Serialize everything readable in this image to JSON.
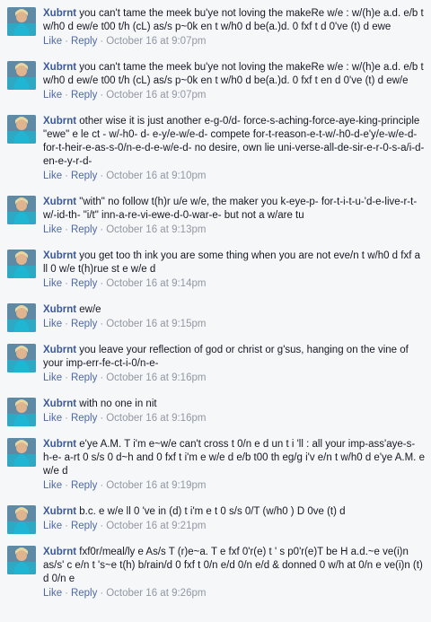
{
  "comments": [
    {
      "author": "Xubrnt",
      "text": "you can't tame the meek bu'ye not loving the makeRe w/e : w/(h)e a.d. e/b t w/h0 d ew/e t00 t/h (cL) as/s p~0k en t w/h0 d be(a.)d. 0 fxf t d 0've (t) d ewe",
      "like": "Like",
      "reply": "Reply",
      "time": "October 16 at 9:07pm"
    },
    {
      "author": "Xubrnt",
      "text": "you can't tame the meek bu'ye not loving the makeRe w/e : w/(h)e a.d. e/b t w/h0 d ew/e t00 t/h (cL) as/s p~0k en t w/h0 d be(a.)d. 0 fxf t en d 0've (t) d ew/e",
      "like": "Like",
      "reply": "Reply",
      "time": "October 16 at 9:07pm"
    },
    {
      "author": "Xubrnt",
      "text": "other wise it is just another e-g-0/d- force-s-aching-force-aye-king-principle \"ewe\" e le ct - w/-h0- d- e-y/e-w/e-d- compete for-t-reason-e-t-w/-h0-d-e'y/e-w/e-d-for-t-heir-e-as-s-0/n-e-d-e-w/e-d- no desire, own lie uni-verse-all-de-sir-e-r-0-s-a/i-d-en-e-y-r-d-",
      "like": "Like",
      "reply": "Reply",
      "time": "October 16 at 9:10pm"
    },
    {
      "author": "Xubrnt",
      "text": "\"with\" no follow t(h)r u/e w/e, the maker you k-eye-p- for-t-i-t-u-'d-e-live-r-t-w/-id-th- \"i/t\" inn-a-re-vi-ewe-d-0-war-e- but not a w/are tu",
      "like": "Like",
      "reply": "Reply",
      "time": "October 16 at 9:13pm"
    },
    {
      "author": "Xubrnt",
      "text": "you get too th ink you are some thing when you are not eve/n t w/h0 d fxf a ll 0 w/e t(h)rue st e w/e d",
      "like": "Like",
      "reply": "Reply",
      "time": "October 16 at 9:14pm"
    },
    {
      "author": "Xubrnt",
      "text": "ew/e",
      "like": "Like",
      "reply": "Reply",
      "time": "October 16 at 9:15pm"
    },
    {
      "author": "Xubrnt",
      "text": "you leave your reflection of god or christ or g'sus, hanging on the vine of your imp-err-fe-ct-i-0/n-e-",
      "like": "Like",
      "reply": "Reply",
      "time": "October 16 at 9:16pm"
    },
    {
      "author": "Xubrnt",
      "text": "with no one in nit",
      "like": "Like",
      "reply": "Reply",
      "time": "October 16 at 9:16pm"
    },
    {
      "author": "Xubrnt",
      "text": "e'ye A.M. T i'm e~w/e can't cross t 0/n e d un t i 'll : all your imp-ass'aye-s- h-e- a-rt 0 s/s 0 d~h and 0 fxf t i'm e w/e d e/b t00 th eg/g i'v e/n t w/h0 d e'ye A.M. e w/e d",
      "like": "Like",
      "reply": "Reply",
      "time": "October 16 at 9:19pm"
    },
    {
      "author": "Xubrnt",
      "text": "b.c. e w/e ll 0 've in (d) t i'm e t 0 s/s 0/T (w/h0 ) D 0ve (t) d",
      "like": "Like",
      "reply": "Reply",
      "time": "October 16 at 9:21pm"
    },
    {
      "author": "Xubrnt",
      "text": "fxf0r/meal/ly e As/s T (r)e~a. T e fxf 0'r(e) t ' s p0'r(e)T be H a.d.~e ve(i)n as/s' c e/n t 's~e t(h) b/rain/d 0 fxf t 0/n e/d 0/n e/d & donned 0 w/h at 0/n e ve(i)n (t) d 0/n e",
      "like": "Like",
      "reply": "Reply",
      "time": "October 16 at 9:26pm"
    }
  ],
  "colors": {
    "author": "#3b5998",
    "link": "#4e69a2",
    "meta": "#9197a3",
    "background": "#f6f7f9"
  },
  "icons": {
    "avatar": "profile-photo-icon"
  }
}
